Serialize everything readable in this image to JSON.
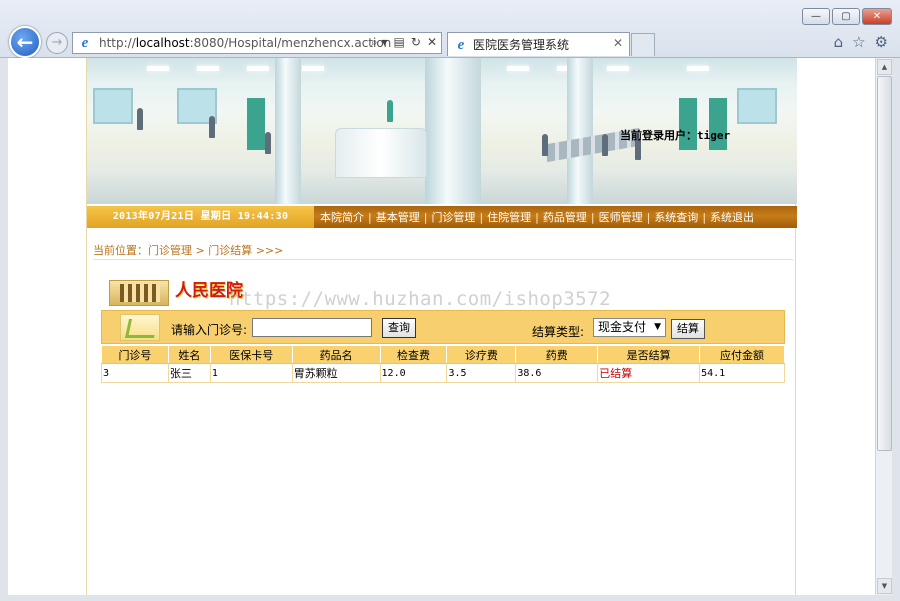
{
  "browser": {
    "url_prefix": "http://",
    "url_host": "localhost",
    "url_rest": ":8080/Hospital/menzhencx.action",
    "tab_title": "医院医务管理系统",
    "addr_tools": [
      "⌕ ▾",
      "▤",
      "↻",
      "✕"
    ],
    "tab_close": "✕",
    "window_buttons": [
      "—",
      "▢",
      "✕"
    ],
    "right_icons": [
      "⌂",
      "☆",
      "⚙"
    ]
  },
  "banner": {
    "login_user": "当前登录用户：tiger"
  },
  "nav": {
    "datetime": "2013年07月21日 星期日 19:44:30",
    "items": [
      "本院简介",
      "基本管理",
      "门诊管理",
      "住院管理",
      "药品管理",
      "医师管理",
      "系统查询",
      "系统退出"
    ],
    "separator": "|"
  },
  "breadcrumb": "当前位置：门诊管理 > 门诊结算 >>>",
  "logo_text": "人民医院",
  "watermark": "https://www.huzhan.com/ishop3572",
  "search": {
    "label": "请输入门诊号:",
    "input_value": "",
    "query_button": "查询",
    "settle_type_label": "结算类型:",
    "settle_type_selected": "现金支付",
    "settle_button": "结算"
  },
  "table": {
    "headers": [
      "门诊号",
      "姓名",
      "医保卡号",
      "药品名",
      "检查费",
      "诊疗费",
      "药费",
      "是否结算",
      "应付金额"
    ],
    "rows": [
      [
        "3",
        "张三",
        "1",
        "胃苏颗粒",
        "12.0",
        "3.5",
        "38.6",
        "已结算",
        "54.1"
      ]
    ]
  }
}
